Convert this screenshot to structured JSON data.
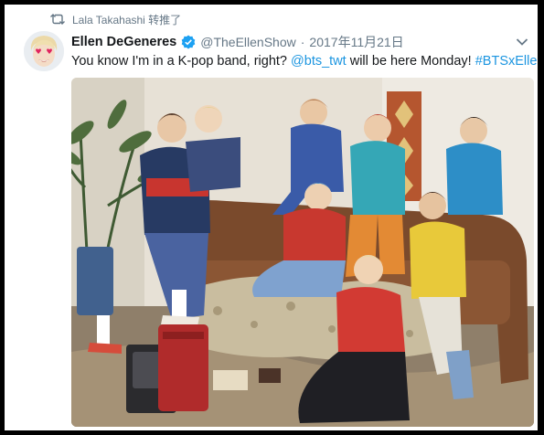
{
  "retweet": {
    "icon": "retweet-icon",
    "text": "Lala Takahashi 转推了"
  },
  "tweet": {
    "author_name": "Ellen DeGeneres",
    "verified_icon": "verified-badge-icon",
    "handle": "@TheEllenShow",
    "separator": "·",
    "date": "2017年11月21日",
    "text_before": "You know I'm in a K-pop band, right? ",
    "mention": "@bts_twt",
    "text_middle": " will be here Monday! ",
    "hashtag": "#BTSxEllen",
    "menu_icon": "chevron-down-icon"
  },
  "colors": {
    "link": "#1b95e0",
    "muted": "#657786",
    "text": "#14171a",
    "verified": "#1da1f2",
    "frame": "#000000"
  }
}
